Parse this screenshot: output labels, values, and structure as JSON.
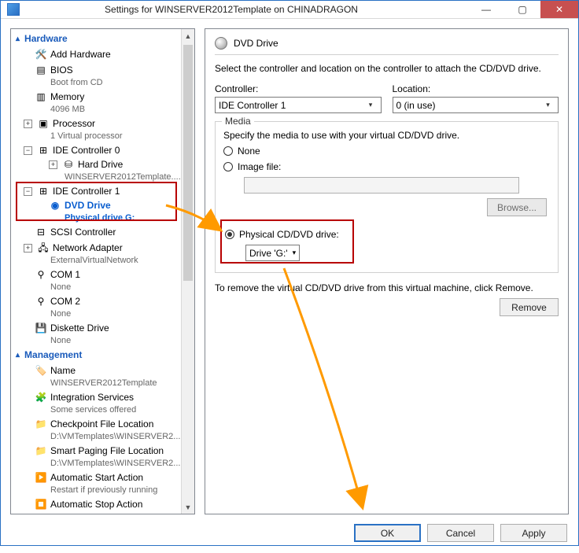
{
  "window": {
    "title": "Settings for WINSERVER2012Template on CHINADRAGON"
  },
  "sections": {
    "hardware": "Hardware",
    "management": "Management"
  },
  "tree": {
    "add_hardware": "Add Hardware",
    "bios": "BIOS",
    "bios_sub": "Boot from CD",
    "memory": "Memory",
    "memory_sub": "4096 MB",
    "processor": "Processor",
    "processor_sub": "1 Virtual processor",
    "ide0": "IDE Controller 0",
    "hard_drive": "Hard Drive",
    "hard_drive_sub": "WINSERVER2012Template....",
    "ide1": "IDE Controller 1",
    "dvd_drive": "DVD Drive",
    "dvd_drive_sub": "Physical drive G:",
    "scsi": "SCSI Controller",
    "net": "Network Adapter",
    "net_sub": "ExternalVirtualNetwork",
    "com1": "COM 1",
    "com1_sub": "None",
    "com2": "COM 2",
    "com2_sub": "None",
    "diskette": "Diskette Drive",
    "diskette_sub": "None",
    "name": "Name",
    "name_sub": "WINSERVER2012Template",
    "integ": "Integration Services",
    "integ_sub": "Some services offered",
    "chk": "Checkpoint File Location",
    "chk_sub": "D:\\VMTemplates\\WINSERVER2...",
    "smart": "Smart Paging File Location",
    "smart_sub": "D:\\VMTemplates\\WINSERVER2...",
    "astart": "Automatic Start Action",
    "astart_sub": "Restart if previously running",
    "astop": "Automatic Stop Action"
  },
  "right": {
    "heading": "DVD Drive",
    "intro": "Select the controller and location on the controller to attach the CD/DVD drive.",
    "controller_label": "Controller:",
    "controller_value": "IDE Controller 1",
    "location_label": "Location:",
    "location_value": "0 (in use)",
    "media_legend": "Media",
    "media_intro": "Specify the media to use with your virtual CD/DVD drive.",
    "radio_none": "None",
    "radio_image": "Image file:",
    "browse": "Browse...",
    "radio_physical": "Physical CD/DVD drive:",
    "physical_value": "Drive 'G:'",
    "remove_text": "To remove the virtual CD/DVD drive from this virtual machine, click Remove.",
    "remove_btn": "Remove"
  },
  "footer": {
    "ok": "OK",
    "cancel": "Cancel",
    "apply": "Apply"
  }
}
